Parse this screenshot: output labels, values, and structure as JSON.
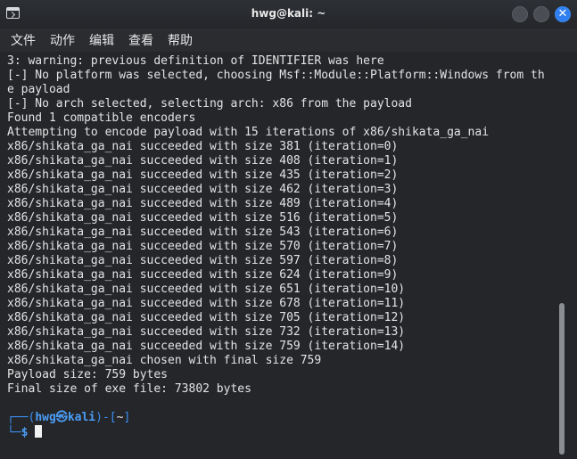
{
  "window": {
    "title": "hwg@kali: ~",
    "icon": "terminal-icon",
    "controls": [
      "minimize-icon",
      "maximize-icon",
      "close-icon"
    ],
    "close_glyph": "✕"
  },
  "menu": {
    "items": [
      "文件",
      "动作",
      "编辑",
      "查看",
      "帮助"
    ]
  },
  "terminal": {
    "lines": [
      "3: warning: previous definition of IDENTIFIER was here",
      "[-] No platform was selected, choosing Msf::Module::Platform::Windows from th",
      "e payload",
      "[-] No arch selected, selecting arch: x86 from the payload",
      "Found 1 compatible encoders",
      "Attempting to encode payload with 15 iterations of x86/shikata_ga_nai",
      "x86/shikata_ga_nai succeeded with size 381 (iteration=0)",
      "x86/shikata_ga_nai succeeded with size 408 (iteration=1)",
      "x86/shikata_ga_nai succeeded with size 435 (iteration=2)",
      "x86/shikata_ga_nai succeeded with size 462 (iteration=3)",
      "x86/shikata_ga_nai succeeded with size 489 (iteration=4)",
      "x86/shikata_ga_nai succeeded with size 516 (iteration=5)",
      "x86/shikata_ga_nai succeeded with size 543 (iteration=6)",
      "x86/shikata_ga_nai succeeded with size 570 (iteration=7)",
      "x86/shikata_ga_nai succeeded with size 597 (iteration=8)",
      "x86/shikata_ga_nai succeeded with size 624 (iteration=9)",
      "x86/shikata_ga_nai succeeded with size 651 (iteration=10)",
      "x86/shikata_ga_nai succeeded with size 678 (iteration=11)",
      "x86/shikata_ga_nai succeeded with size 705 (iteration=12)",
      "x86/shikata_ga_nai succeeded with size 732 (iteration=13)",
      "x86/shikata_ga_nai succeeded with size 759 (iteration=14)",
      "x86/shikata_ga_nai chosen with final size 759",
      "Payload size: 759 bytes",
      "Final size of exe file: 73802 bytes"
    ],
    "prompt": {
      "open": "┌──(",
      "user": "hwg",
      "at": "㉿",
      "host": "kali",
      "close": ")-[",
      "path": "~",
      "end": "]",
      "second_line": "└─",
      "symbol": "$"
    }
  },
  "colors": {
    "prompt_blue": "#3b8ff2",
    "close_button": "#2f7ff0"
  }
}
